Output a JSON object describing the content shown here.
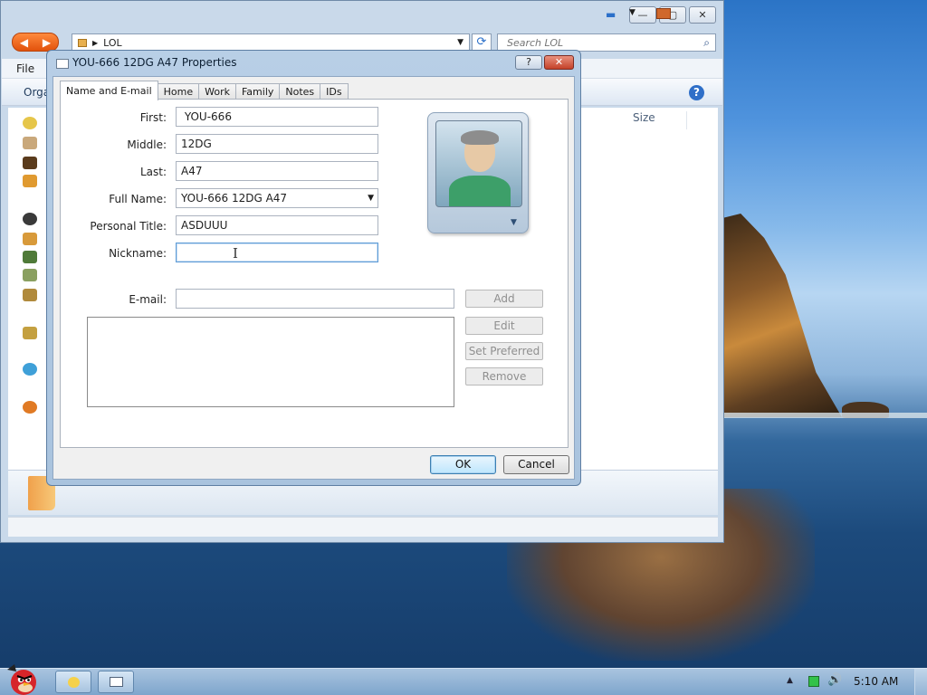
{
  "explorer": {
    "address_path": "LOL",
    "search_placeholder": "Search LOL",
    "menu_file": "File",
    "toolbar_organize": "Orga",
    "column_size": "Size",
    "min_glyph": "—",
    "max_glyph": "▢",
    "close_glyph": "✕",
    "back_glyph": "◀",
    "forward_glyph": "▶"
  },
  "dialog": {
    "title": "YOU-666 12DG A47 Properties",
    "help_glyph": "?",
    "close_glyph": "✕",
    "tabs": [
      {
        "label": "Name and E-mail"
      },
      {
        "label": "Home"
      },
      {
        "label": "Work"
      },
      {
        "label": "Family"
      },
      {
        "label": "Notes"
      },
      {
        "label": "IDs"
      }
    ],
    "fields": {
      "first_label": "First:",
      "first_value": " YOU-666",
      "middle_label": "Middle:",
      "middle_value": "12DG",
      "last_label": "Last:",
      "last_value": "A47",
      "fullname_label": "Full Name:",
      "fullname_value": "YOU-666 12DG A47",
      "personal_title_label": "Personal Title:",
      "personal_title_value": "ASDUUU",
      "nickname_label": "Nickname:",
      "nickname_value": "",
      "email_label": "E-mail:",
      "email_value": ""
    },
    "buttons": {
      "add": "Add",
      "edit": "Edit",
      "set_preferred": "Set Preferred",
      "remove": "Remove",
      "ok": "OK",
      "cancel": "Cancel"
    }
  },
  "taskbar": {
    "clock": "5:10 AM",
    "tray_expand_glyph": "▲"
  },
  "icons": {
    "dropdown": "▼",
    "refresh": "⟳",
    "search": "🔍",
    "volume": "🔊",
    "ibeam": "I"
  }
}
